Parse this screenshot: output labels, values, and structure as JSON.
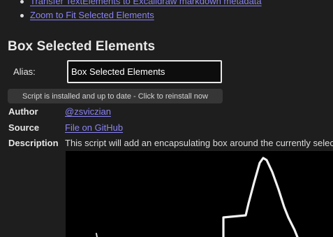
{
  "links": [
    {
      "label": "Transfer TextElements to Excalidraw markdown metadata"
    },
    {
      "label": "Zoom to Fit Selected Elements"
    }
  ],
  "heading": "Box Selected Elements",
  "alias": {
    "label": "Alias:",
    "value": "Box Selected Elements"
  },
  "install_button": "Script is installed and up to date - Click to reinstall now",
  "meta": {
    "author_key": "Author",
    "author_value": "@zsviczian",
    "source_key": "Source",
    "source_value": "File on GitHub",
    "description_key": "Description",
    "description_value": "This script will add an encapsulating box around the currently selected elements in Excalidraw."
  }
}
